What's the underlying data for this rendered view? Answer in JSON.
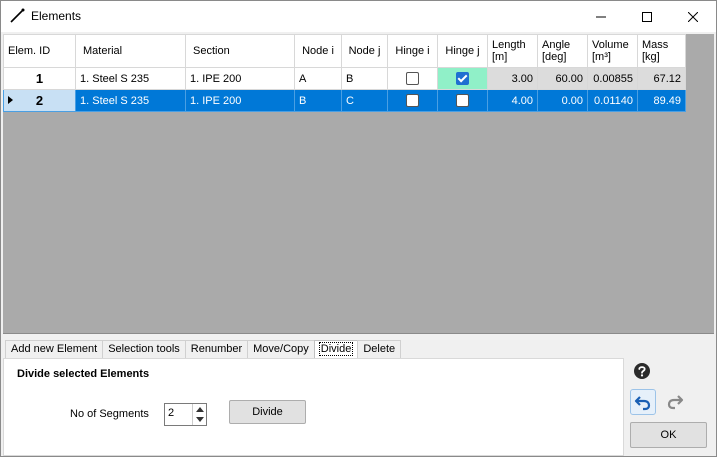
{
  "window": {
    "title": "Elements"
  },
  "grid": {
    "columns": [
      {
        "label": "Elem. ID"
      },
      {
        "label": "Material"
      },
      {
        "label": "Section"
      },
      {
        "label": "Node i"
      },
      {
        "label": "Node j"
      },
      {
        "label": "Hinge i"
      },
      {
        "label": "Hinge j"
      },
      {
        "label": "Length",
        "unit": "[m]"
      },
      {
        "label": "Angle",
        "unit": "[deg]"
      },
      {
        "label": "Volume",
        "unit": "[m³]"
      },
      {
        "label": "Mass",
        "unit": "[kg]"
      }
    ],
    "rows": [
      {
        "id": "1",
        "material": "1. Steel S 235",
        "section": "1. IPE 200",
        "node_i": "A",
        "node_j": "B",
        "hinge_i": false,
        "hinge_j": true,
        "length": "3.00",
        "angle": "60.00",
        "volume": "0.00855",
        "mass": "67.12",
        "selected": false
      },
      {
        "id": "2",
        "material": "1. Steel S 235",
        "section": "1. IPE 200",
        "node_i": "B",
        "node_j": "C",
        "hinge_i": false,
        "hinge_j": false,
        "length": "4.00",
        "angle": "0.00",
        "volume": "0.01140",
        "mass": "89.49",
        "selected": true
      }
    ]
  },
  "tabs": [
    {
      "label": "Add new Element"
    },
    {
      "label": "Selection tools"
    },
    {
      "label": "Renumber"
    },
    {
      "label": "Move/Copy"
    },
    {
      "label": "Divide"
    },
    {
      "label": "Delete"
    }
  ],
  "active_tab": "Divide",
  "divide_panel": {
    "title": "Divide selected Elements",
    "segments_label": "No of Segments",
    "segments_value": "2",
    "divide_button": "Divide"
  },
  "side": {
    "ok_label": "OK"
  },
  "colors": {
    "selection": "#0078d7",
    "hinge_highlight": "#90f0c8",
    "grid_background": "#aaaaaa"
  }
}
